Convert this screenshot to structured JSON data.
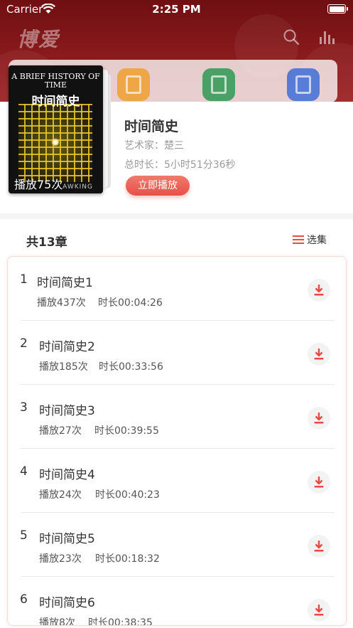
{
  "status_bar": {
    "carrier": "Carrier",
    "time": "2:25 PM"
  },
  "header": {
    "logo": "博爱"
  },
  "album": {
    "cover_title_en": "A BRIEF HISTORY OF TIME",
    "cover_title_zh": "时间简史",
    "cover_author": "AWKING",
    "play_count": "播放75次",
    "title": "时间简史",
    "artist": "艺术家：楚三",
    "duration": "总时长：5小时51分36秒",
    "play_button": "立即播放"
  },
  "chapters": {
    "count_label": "共13章",
    "select_label": "选集",
    "items": [
      {
        "num": "1",
        "title": "时间简史1",
        "plays": "播放437次",
        "time": "时长00:04:26"
      },
      {
        "num": "2",
        "title": "时间简史2",
        "plays": "播放185次",
        "time": "时长00:33:56"
      },
      {
        "num": "3",
        "title": "时间简史3",
        "plays": "播放27次",
        "time": "时长00:39:55"
      },
      {
        "num": "4",
        "title": "时间简史4",
        "plays": "播放24次",
        "time": "时长00:40:23"
      },
      {
        "num": "5",
        "title": "时间简史5",
        "plays": "播放23次",
        "time": "时长00:18:32"
      },
      {
        "num": "6",
        "title": "时间简史6",
        "plays": "播放8次",
        "time": "时长00:38:35"
      }
    ]
  },
  "colors": {
    "accent": "#e94a45",
    "header": "#8a1a1c"
  }
}
